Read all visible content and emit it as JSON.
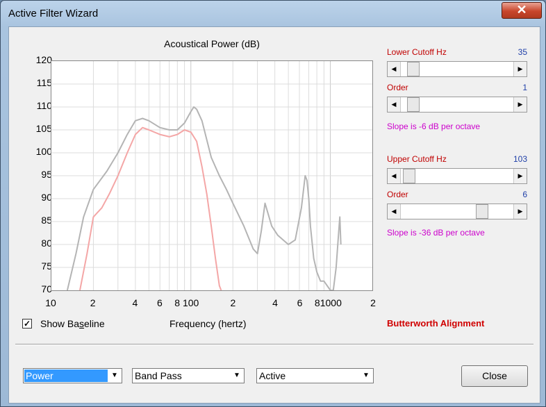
{
  "window": {
    "title": "Active Filter Wizard",
    "close_glyph": "✕"
  },
  "chart": {
    "title": "Acoustical Power (dB)",
    "x_axis_label": "Frequency (hertz)",
    "y_ticks": [
      "120",
      "115",
      "110",
      "105",
      "100",
      "95",
      "90",
      "85",
      "80",
      "75",
      "70"
    ],
    "x_ticks": [
      "10",
      "2",
      "4",
      "6",
      "8",
      "100",
      "2",
      "4",
      "6",
      "8",
      "1000",
      "2"
    ]
  },
  "chart_data": {
    "type": "line",
    "title": "Acoustical Power (dB)",
    "xlabel": "Frequency (hertz)",
    "ylabel": "",
    "xscale": "log",
    "xlim": [
      10,
      2000
    ],
    "ylim": [
      70,
      120
    ],
    "grid": true,
    "series": [
      {
        "color": "#b4b4b4",
        "x": [
          13,
          15,
          17,
          20,
          25,
          30,
          35,
          40,
          45,
          50,
          60,
          70,
          80,
          90,
          100,
          105,
          110,
          120,
          140,
          160,
          180,
          200,
          240,
          280,
          300,
          320,
          340,
          380,
          420,
          500,
          560,
          620,
          660,
          680,
          700,
          720,
          760,
          800,
          850,
          900,
          1000,
          1050,
          1100,
          1150,
          1170,
          1190
        ],
        "y": [
          70,
          78,
          86,
          92,
          96,
          100,
          104,
          107,
          107.5,
          107,
          105.5,
          105,
          105,
          106.5,
          109,
          110,
          109.5,
          107,
          99,
          95,
          92,
          89,
          84,
          79,
          78,
          83,
          89,
          84,
          82,
          80,
          81,
          88,
          95,
          94,
          90,
          84,
          77,
          74,
          72,
          72,
          70,
          70,
          75,
          83,
          86,
          80
        ]
      },
      {
        "color": "#f4a6a6",
        "x": [
          16,
          18,
          20,
          23,
          26,
          30,
          35,
          40,
          45,
          50,
          60,
          70,
          80,
          90,
          100,
          110,
          120,
          130,
          140,
          150,
          160,
          165
        ],
        "y": [
          70,
          78,
          86,
          88,
          91,
          95,
          100,
          104,
          105.5,
          105,
          104,
          103.5,
          104,
          105,
          104.5,
          102.5,
          97,
          91,
          84,
          77,
          71,
          70
        ]
      }
    ]
  },
  "baseline": {
    "label": "Show Baseline",
    "mnemonic_index": 7,
    "checked": "✓"
  },
  "lower": {
    "cutoff_label": "Lower Cutoff  Hz",
    "cutoff_value": "35",
    "order_label": "Order",
    "order_value": "1",
    "slope": "Slope is -6 dB per octave"
  },
  "upper": {
    "cutoff_label": "Upper Cutoff  Hz",
    "cutoff_value": "103",
    "order_label": "Order",
    "order_value": "6",
    "slope": "Slope is -36 dB per octave"
  },
  "alignment": "Butterworth Alignment",
  "combos": {
    "mode": "Power",
    "filter_type": "Band Pass",
    "implementation": "Active"
  },
  "buttons": {
    "close": "Close"
  },
  "arrows": {
    "left": "◀",
    "right": "▶",
    "down": "▼"
  },
  "sliders": {
    "lower_cutoff_fraction": 0.06,
    "lower_order_fraction": 0.06,
    "upper_cutoff_fraction": 0.02,
    "upper_order_fraction": 0.75
  }
}
